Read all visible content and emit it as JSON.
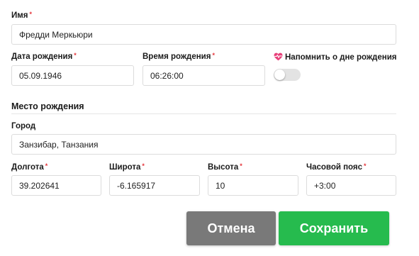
{
  "form": {
    "name": {
      "label": "Имя",
      "required_mark": "*",
      "value": "Фредди Меркьюри"
    },
    "birth_date": {
      "label": "Дата рождения",
      "required_mark": "*",
      "value": "05.09.1946"
    },
    "birth_time": {
      "label": "Время рождения",
      "required_mark": "*",
      "value": "06:26:00"
    },
    "birthday_reminder": {
      "label": "Напомнить о дне рождения",
      "icon": "heart-pulse-icon",
      "icon_color": "#e8407a",
      "enabled": false
    },
    "birth_place": {
      "section_title": "Место рождения",
      "city": {
        "label": "Город",
        "value": "Занзибар, Танзания"
      },
      "longitude": {
        "label": "Долгота",
        "required_mark": "*",
        "value": "39.202641"
      },
      "latitude": {
        "label": "Широта",
        "required_mark": "*",
        "value": "-6.165917"
      },
      "altitude": {
        "label": "Высота",
        "required_mark": "*",
        "value": "10"
      },
      "timezone": {
        "label": "Часовой пояс",
        "required_mark": "*",
        "value": "+3:00"
      }
    }
  },
  "actions": {
    "cancel_label": "Отмена",
    "save_label": "Сохранить"
  },
  "colors": {
    "required": "#e4343a",
    "cancel_button": "#797979",
    "save_button": "#26bb4e",
    "field_border": "#dcdcdc"
  }
}
